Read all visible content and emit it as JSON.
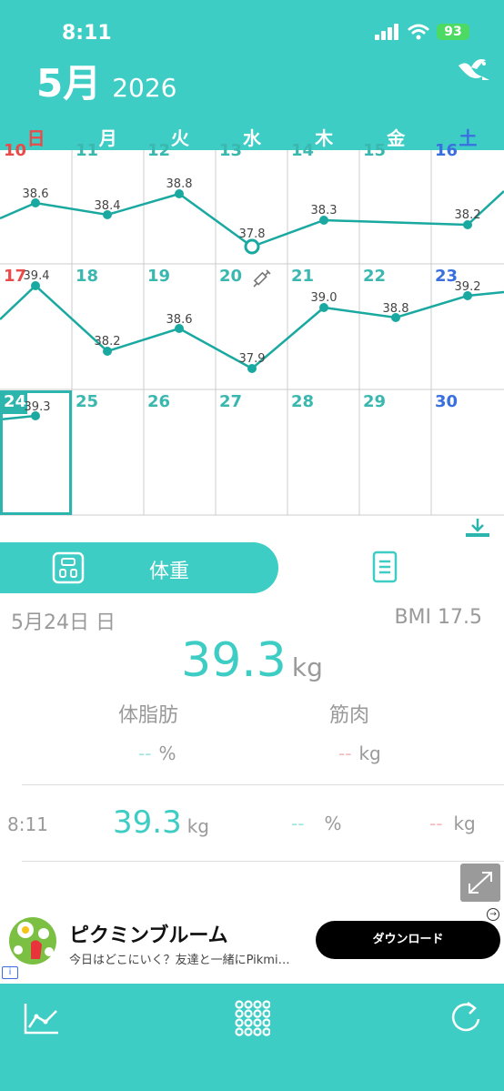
{
  "status": {
    "time": "8:11",
    "battery": "93"
  },
  "header": {
    "month": "5月",
    "year": "2026"
  },
  "weekdays": [
    "日",
    "月",
    "火",
    "水",
    "木",
    "金",
    "土"
  ],
  "calendar": {
    "week1": {
      "days": [
        "10",
        "11",
        "12",
        "13",
        "14",
        "15",
        "16"
      ],
      "values": [
        "38.6",
        "38.4",
        "38.8",
        "37.8",
        "38.3",
        "",
        "38.2"
      ]
    },
    "week2": {
      "days": [
        "17",
        "18",
        "19",
        "20",
        "21",
        "22",
        "23"
      ],
      "values": [
        "39.4",
        "38.2",
        "38.6",
        "37.9",
        "39.0",
        "38.8",
        "39.2"
      ]
    },
    "week3": {
      "days": [
        "24",
        "25",
        "26",
        "27",
        "28",
        "29",
        "30"
      ],
      "values": [
        "39.3",
        "",
        "",
        "",
        "",
        "",
        ""
      ]
    }
  },
  "tabs": {
    "weight_label": "体重"
  },
  "summary": {
    "date": "5月24日 日",
    "bmi": "BMI 17.5",
    "weight": "39.3",
    "weight_unit": "kg",
    "fat_label": "体脂肪",
    "muscle_label": "筋肉",
    "fat_value": "--",
    "fat_unit": "%",
    "muscle_value": "--",
    "muscle_unit": "kg"
  },
  "record": {
    "time": "8:11",
    "weight": "39.3",
    "weight_unit": "kg",
    "fat": "--",
    "fat_unit": "%",
    "muscle": "--",
    "muscle_unit": "kg"
  },
  "ad": {
    "title": "ピクミンブルーム",
    "description": "今日はどこにいく？友達と一緒にPikmi…",
    "button": "ダウンロード",
    "info": "i"
  },
  "colors": {
    "accent": "#3ecdc5",
    "line": "#1aa9a1",
    "sunday": "#e94b4b",
    "saturday": "#3a6fe0"
  }
}
